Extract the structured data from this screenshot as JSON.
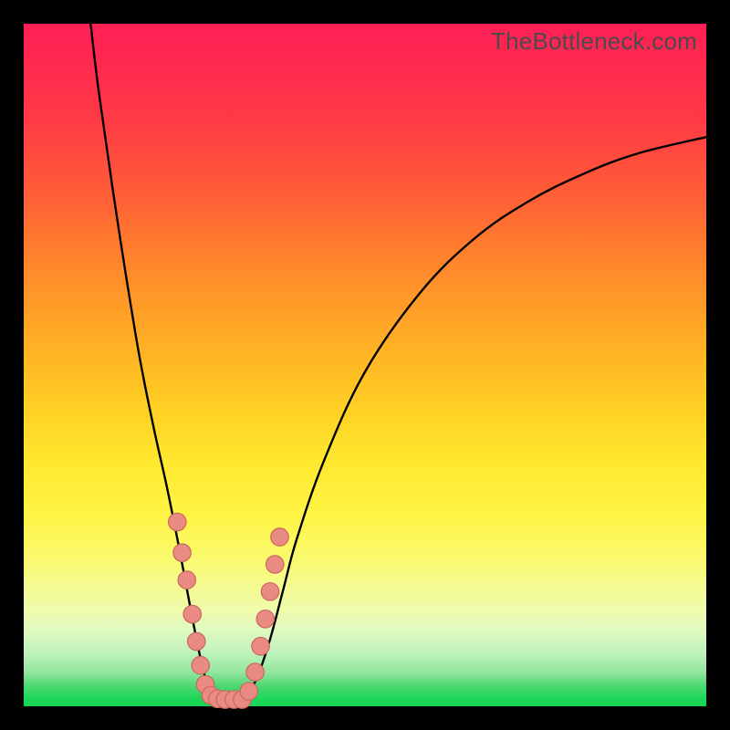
{
  "watermark": "TheBottleneck.com",
  "colors": {
    "frame": "#000000",
    "curve": "#000000",
    "marker_fill": "#e98b82",
    "marker_stroke": "#c9675e"
  },
  "chart_data": {
    "type": "line",
    "title": "",
    "xlabel": "",
    "ylabel": "",
    "xlim": [
      0,
      100
    ],
    "ylim": [
      0,
      100
    ],
    "grid": false,
    "legend": false,
    "note": "Values are in percent of plot area; y=0 at bottom, x=0 at left. Curve approximates a V / funnel shape.",
    "series": [
      {
        "name": "curve",
        "x": [
          9.8,
          11,
          13,
          15,
          17,
          19,
          21,
          23,
          24.5,
          25.8,
          27,
          28,
          32,
          34,
          36,
          38,
          40,
          44,
          50,
          58,
          66,
          74,
          82,
          90,
          100
        ],
        "y": [
          100,
          90,
          76,
          63,
          51,
          41,
          32,
          22,
          14,
          7.5,
          2.8,
          1.1,
          1.0,
          3.8,
          9.5,
          17,
          24.5,
          36,
          49,
          60.5,
          68.5,
          74,
          78,
          81,
          83.4
        ]
      }
    ],
    "markers": {
      "name": "dots",
      "note": "Salmon circular markers clustered near the bottom of the V on both arms and along the trough.",
      "x": [
        22.5,
        23.2,
        23.9,
        24.7,
        25.3,
        25.9,
        26.6,
        27.4,
        28.4,
        29.5,
        30.8,
        32.0,
        33.0,
        33.9,
        34.7,
        35.4,
        36.1,
        36.8,
        37.5
      ],
      "y": [
        27.0,
        22.5,
        18.5,
        13.5,
        9.5,
        6.0,
        3.2,
        1.6,
        1.1,
        1.0,
        1.0,
        1.0,
        2.2,
        5.0,
        8.8,
        12.8,
        16.8,
        20.8,
        24.8
      ],
      "r": 1.3
    }
  }
}
